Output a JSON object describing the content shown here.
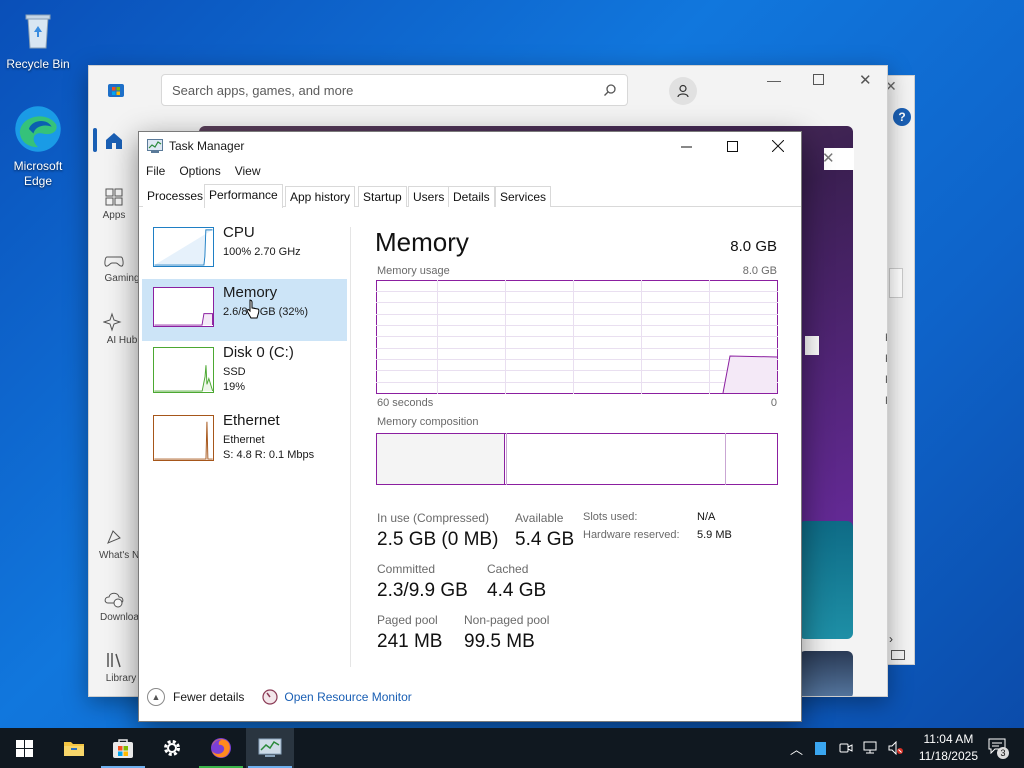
{
  "desktop": {
    "icons": [
      {
        "label": "Recycle Bin"
      },
      {
        "label": "Microsoft Edge"
      }
    ]
  },
  "store": {
    "search_placeholder": "Search apps, games, and more",
    "nav": [
      "Apps",
      "Gaming",
      "AI Hub",
      "What's New",
      "Downloads",
      "Library"
    ],
    "side_sizes": [
      "KB",
      "KB",
      "KB",
      "KB"
    ]
  },
  "task_manager": {
    "title": "Task Manager",
    "menu": [
      "File",
      "Options",
      "View"
    ],
    "tabs": [
      "Processes",
      "Performance",
      "App history",
      "Startup",
      "Users",
      "Details",
      "Services"
    ],
    "active_tab": "Performance",
    "sidebar": [
      {
        "name": "CPU",
        "sub1": "100%  2.70 GHz",
        "sub2": "",
        "color": "#1f7fc4"
      },
      {
        "name": "Memory",
        "sub1": "2.6/8.0 GB (32%)",
        "sub2": "",
        "color": "#8b1fa0"
      },
      {
        "name": "Disk 0 (C:)",
        "sub1": "SSD",
        "sub2": "19%",
        "color": "#4ca832"
      },
      {
        "name": "Ethernet",
        "sub1": "Ethernet",
        "sub2": "S: 4.8  R: 0.1 Mbps",
        "color": "#a6561a"
      }
    ],
    "selected_resource": "Memory",
    "main": {
      "title": "Memory",
      "capacity": "8.0 GB",
      "usage_label": "Memory usage",
      "usage_max": "8.0 GB",
      "time_left": "60 seconds",
      "time_right": "0",
      "composition_label": "Memory composition",
      "graph_color": "#8b1fa0",
      "stats": [
        {
          "label": "In use (Compressed)",
          "value": "2.5 GB (0 MB)"
        },
        {
          "label": "Available",
          "value": "5.4 GB"
        },
        {
          "label": "Committed",
          "value": "2.3/9.9 GB"
        },
        {
          "label": "Cached",
          "value": "4.4 GB"
        },
        {
          "label": "Paged pool",
          "value": "241 MB"
        },
        {
          "label": "Non-paged pool",
          "value": "99.5 MB"
        }
      ],
      "details": [
        {
          "label": "Slots used:",
          "value": "N/A"
        },
        {
          "label": "Hardware reserved:",
          "value": "5.9 MB"
        }
      ]
    },
    "footer": {
      "fewer_details": "Fewer details",
      "resource_monitor": "Open Resource Monitor"
    }
  },
  "taskbar": {
    "clock_time": "11:04 AM",
    "clock_date": "11/18/2025",
    "notification_count": "3"
  }
}
